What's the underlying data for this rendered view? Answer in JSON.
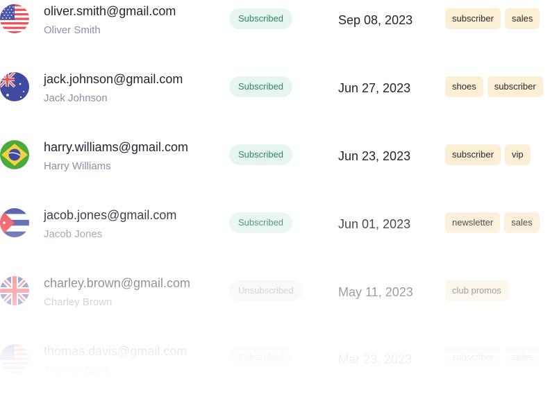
{
  "subscribers": [
    {
      "email": "oliver.smith@gmail.com",
      "name": "Oliver Smith",
      "country_flag": "us-flag-icon",
      "status": "Subscribed",
      "date": "Sep 08, 2023",
      "tags": [
        "subscriber",
        "sales"
      ]
    },
    {
      "email": "jack.johnson@gmail.com",
      "name": "Jack Johnson",
      "country_flag": "australia-flag-icon",
      "status": "Subscribed",
      "date": "Jun 27, 2023",
      "tags": [
        "shoes",
        "subscriber"
      ]
    },
    {
      "email": "harry.williams@gmail.com",
      "name": "Harry Williams",
      "country_flag": "brazil-flag-icon",
      "status": "Subscribed",
      "date": "Jun 23, 2023",
      "tags": [
        "subscriber",
        "vip"
      ]
    },
    {
      "email": "jacob.jones@gmail.com",
      "name": "Jacob Jones",
      "country_flag": "cuba-flag-icon",
      "status": "Subscribed",
      "date": "Jun 01, 2023",
      "tags": [
        "newsletter",
        "sales"
      ]
    },
    {
      "email": "charley.brown@gmail.com",
      "name": "Charley Brown",
      "country_flag": "uk-flag-icon",
      "status": "Unsubscribed",
      "date": "May 11, 2023",
      "tags": [
        "club promos"
      ]
    },
    {
      "email": "thomas.davis@gmail.com",
      "name": "Thomas Davis",
      "country_flag": "us-flag-icon",
      "status": "Subscribed",
      "date": "Mar 23, 2023",
      "tags": [
        "subscriber",
        "sales"
      ]
    }
  ],
  "colors": {
    "status_bg": "#e6f5ef",
    "status_text": "#2f8a5a",
    "tag_bg": "#fdeed6",
    "unsub_bg": "#f2f3f5",
    "unsub_text": "#9aa0ad"
  }
}
